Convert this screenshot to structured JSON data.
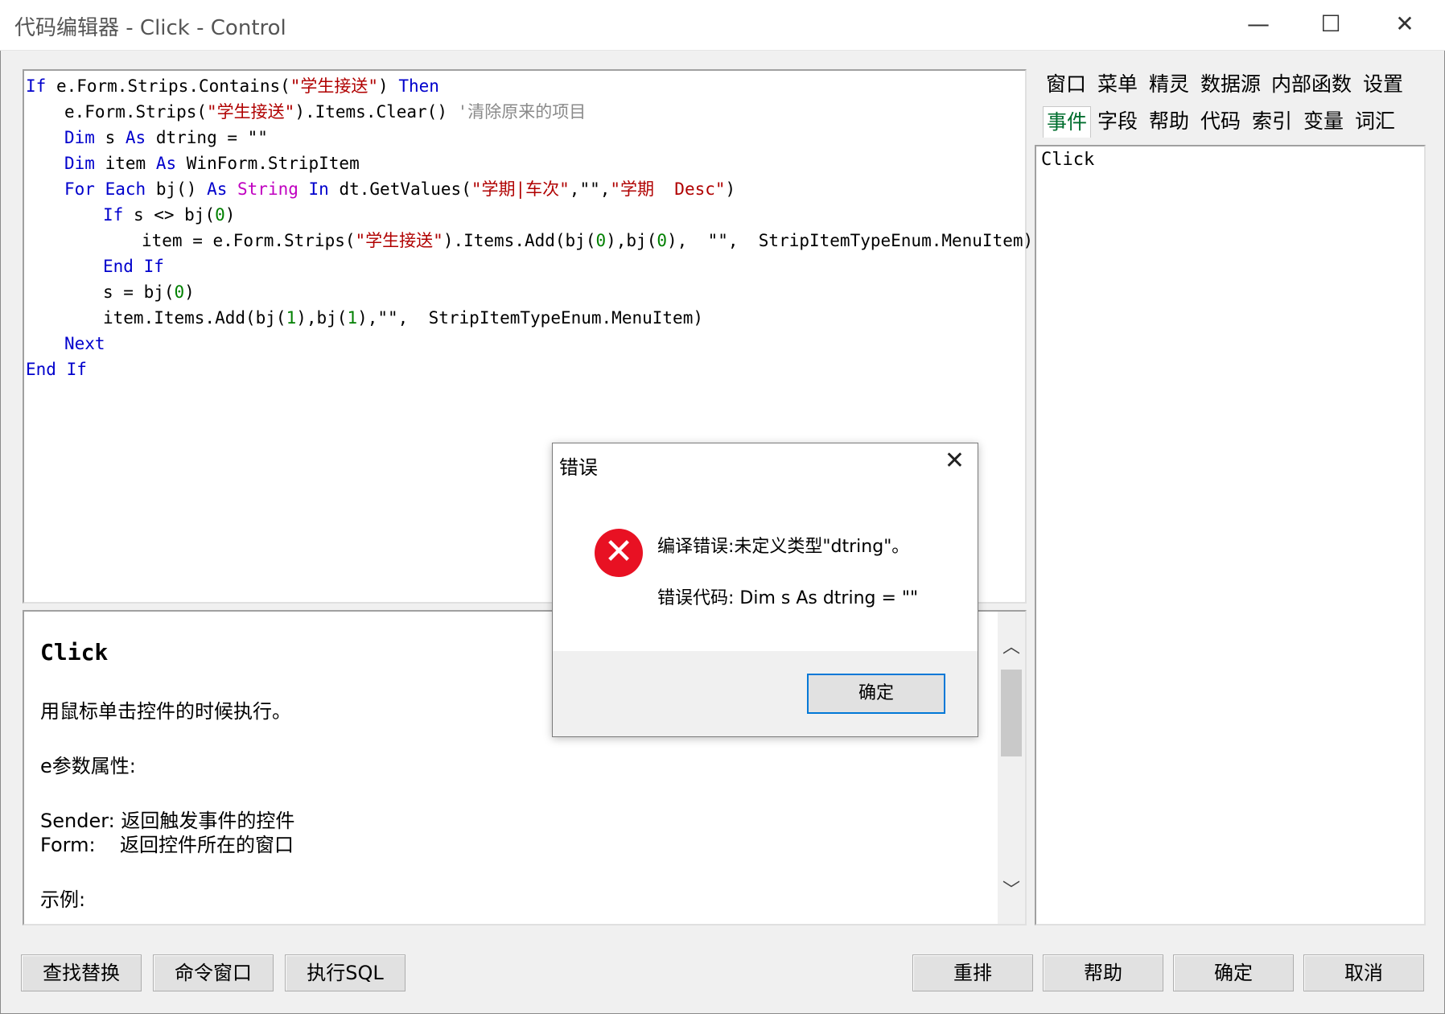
{
  "window": {
    "title": "代码编辑器 - Click - Control",
    "minimize": "—",
    "maximize": "☐",
    "close": "✕"
  },
  "code": {
    "l1": {
      "k1": "If",
      "t1": "e.Form.Strips.Contains(",
      "s1": "\"学生接送\"",
      "t2": ")",
      "k2": "Then"
    },
    "l2": {
      "t1": "e.Form.Strips(",
      "s1": "\"学生接送\"",
      "t2": ").Items.Clear()",
      "c1": "'清除原来的项目"
    },
    "l3": {
      "k1": "Dim",
      "t1": "s",
      "k2": "As",
      "t2": "dtring = \"\""
    },
    "l4": {
      "k1": "Dim",
      "t1": "item",
      "k2": "As",
      "t2": "WinForm.StripItem"
    },
    "l5": {
      "k1": "For",
      "k2": "Each",
      "t1": "bj()",
      "k3": "As",
      "s1": "String",
      "k4": "In",
      "t2": "dt.GetValues(",
      "s2": "\"学期|车次\"",
      "t3": ",\"\",",
      "s3": "\"学期  Desc\"",
      "t4": ")"
    },
    "l6": {
      "k1": "If",
      "t1": "s <> bj(",
      "n1": "0",
      "t2": ")"
    },
    "l7": {
      "t1": "item = e.Form.Strips(",
      "s1": "\"学生接送\"",
      "t2": ").Items.Add(bj(",
      "n1": "0",
      "t3": "),bj(",
      "n2": "0",
      "t4": "),  \"\",  StripItemTypeEnum.MenuItem)"
    },
    "l8": {
      "k1": "End If"
    },
    "l9": {
      "t1": "s = bj(",
      "n1": "0",
      "t2": ")"
    },
    "l10": {
      "t1": "item.Items.Add(bj(",
      "n1": "1",
      "t2": "),bj(",
      "n2": "1",
      "t3": "),\"\",  StripItemTypeEnum.MenuItem)"
    },
    "l11": {
      "k1": "Next"
    },
    "l12": {
      "k1": "End If"
    }
  },
  "help": {
    "title": "Click",
    "desc": "用鼠标单击控件的时候执行。",
    "param_heading": "e参数属性:",
    "sender": "Sender: 返回触发事件的控件",
    "form": "Form:    返回控件所在的窗口",
    "example": "示例:"
  },
  "tabs": {
    "row1": [
      "窗口",
      "菜单",
      "精灵",
      "数据源",
      "内部函数",
      "设置"
    ],
    "row2": [
      "事件",
      "字段",
      "帮助",
      "代码",
      "索引",
      "变量",
      "词汇"
    ]
  },
  "list": {
    "items": [
      "Click"
    ]
  },
  "buttons": {
    "find_replace": "查找替换",
    "command_window": "命令窗口",
    "run_sql": "执行SQL",
    "rearrange": "重排",
    "help": "帮助",
    "ok": "确定",
    "cancel": "取消"
  },
  "dialog": {
    "title": "错误",
    "close": "✕",
    "icon": "✕",
    "message1": "编译错误:未定义类型\"dtring\"。",
    "message2": "错误代码:  Dim s As dtring = \"\"",
    "ok": "确定"
  },
  "colors": {
    "keyword": "#0000cc",
    "string": "#b00000",
    "number": "#008000",
    "comment": "#8a8a8a",
    "error": "#e81123",
    "active_tab": "#006e2e"
  }
}
